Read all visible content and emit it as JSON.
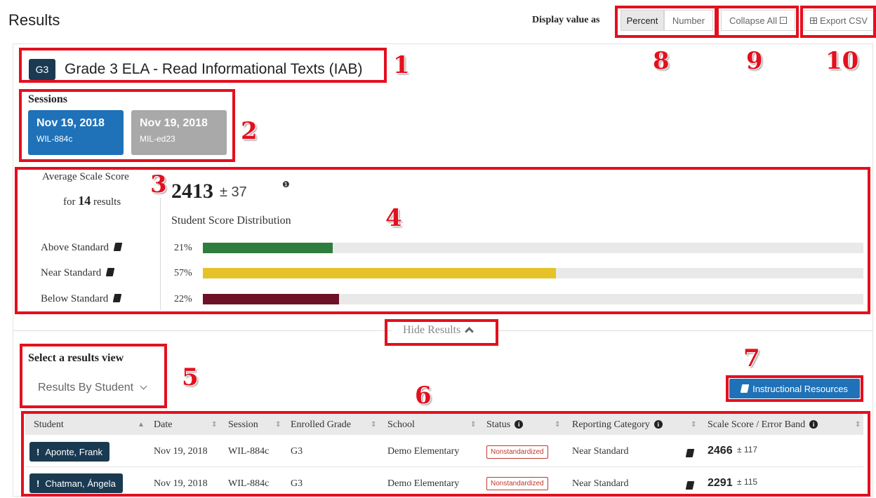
{
  "header": {
    "title": "Results",
    "display_label": "Display value as",
    "percent_label": "Percent",
    "number_label": "Number",
    "collapse_label": "Collapse All",
    "export_label": "Export CSV"
  },
  "assessment": {
    "grade_badge": "G3",
    "title": "Grade 3 ELA - Read Informational Texts (IAB)"
  },
  "sessions": {
    "label": "Sessions",
    "items": [
      {
        "date": "Nov 19, 2018",
        "code": "WIL-884c",
        "color": "#1f72b8"
      },
      {
        "date": "Nov 19, 2018",
        "code": "MIL-ed23",
        "color": "#a9a9a9"
      }
    ]
  },
  "score": {
    "avg_line1": "Average Scale Score",
    "avg_for": "for",
    "count": "14",
    "results_word": "results",
    "value": "2413",
    "error": "± 37",
    "info_mark": "❶",
    "distribution_label": "Student Score Distribution",
    "levels": [
      {
        "name": "Above Standard",
        "pct": "21%",
        "value": 21,
        "color": "#2e7d3e"
      },
      {
        "name": "Near Standard",
        "pct": "57%",
        "value": 57,
        "color": "#e6c229"
      },
      {
        "name": "Below Standard",
        "pct": "22%",
        "value": 22,
        "color": "#6e1128"
      }
    ]
  },
  "hide_results_label": "Hide Results",
  "results_view": {
    "label": "Select a results view",
    "selected": "Results By Student"
  },
  "instructional_resources_label": "Instructional Resources",
  "table": {
    "headers": [
      "Student",
      "Date",
      "Session",
      "Enrolled Grade",
      "School",
      "Status",
      "Reporting Category",
      "Scale Score / Error Band"
    ],
    "rows": [
      {
        "student": "Aponte, Frank",
        "date": "Nov 19, 2018",
        "session": "WIL-884c",
        "grade": "G3",
        "school": "Demo Elementary",
        "status": "Nonstandardized",
        "category": "Near Standard",
        "score": "2466",
        "error": "± 117"
      },
      {
        "student": "Chatman, Ángela",
        "date": "Nov 19, 2018",
        "session": "WIL-884c",
        "grade": "G3",
        "school": "Demo Elementary",
        "status": "Nonstandardized",
        "category": "Near Standard",
        "score": "2291",
        "error": "± 115"
      }
    ]
  },
  "callouts": [
    "1",
    "2",
    "3",
    "4",
    "5",
    "6",
    "7",
    "8",
    "9",
    "10"
  ],
  "colors": {
    "annotation_red": "#e3101e",
    "navy": "#1a3a52",
    "blue": "#1f72b8"
  }
}
